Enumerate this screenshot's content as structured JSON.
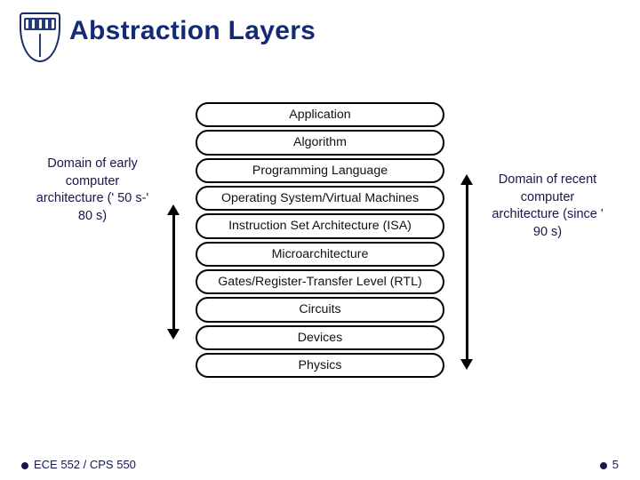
{
  "title": "Abstraction Layers",
  "layers": [
    "Application",
    "Algorithm",
    "Programming Language",
    "Operating System/Virtual Machines",
    "Instruction Set Architecture (ISA)",
    "Microarchitecture",
    "Gates/Register-Transfer Level (RTL)",
    "Circuits",
    "Devices",
    "Physics"
  ],
  "left_caption": "Domain of early computer architecture (' 50 s-' 80 s)",
  "right_caption": "Domain of recent computer architecture (since ' 90 s)",
  "left_arrow_range": {
    "from_layer_index": 3,
    "to_layer_index": 7
  },
  "right_arrow_range": {
    "from_layer_index": 3,
    "to_layer_index": 9
  },
  "footer": {
    "course": "ECE 552 / CPS 550",
    "page_number": "5"
  }
}
